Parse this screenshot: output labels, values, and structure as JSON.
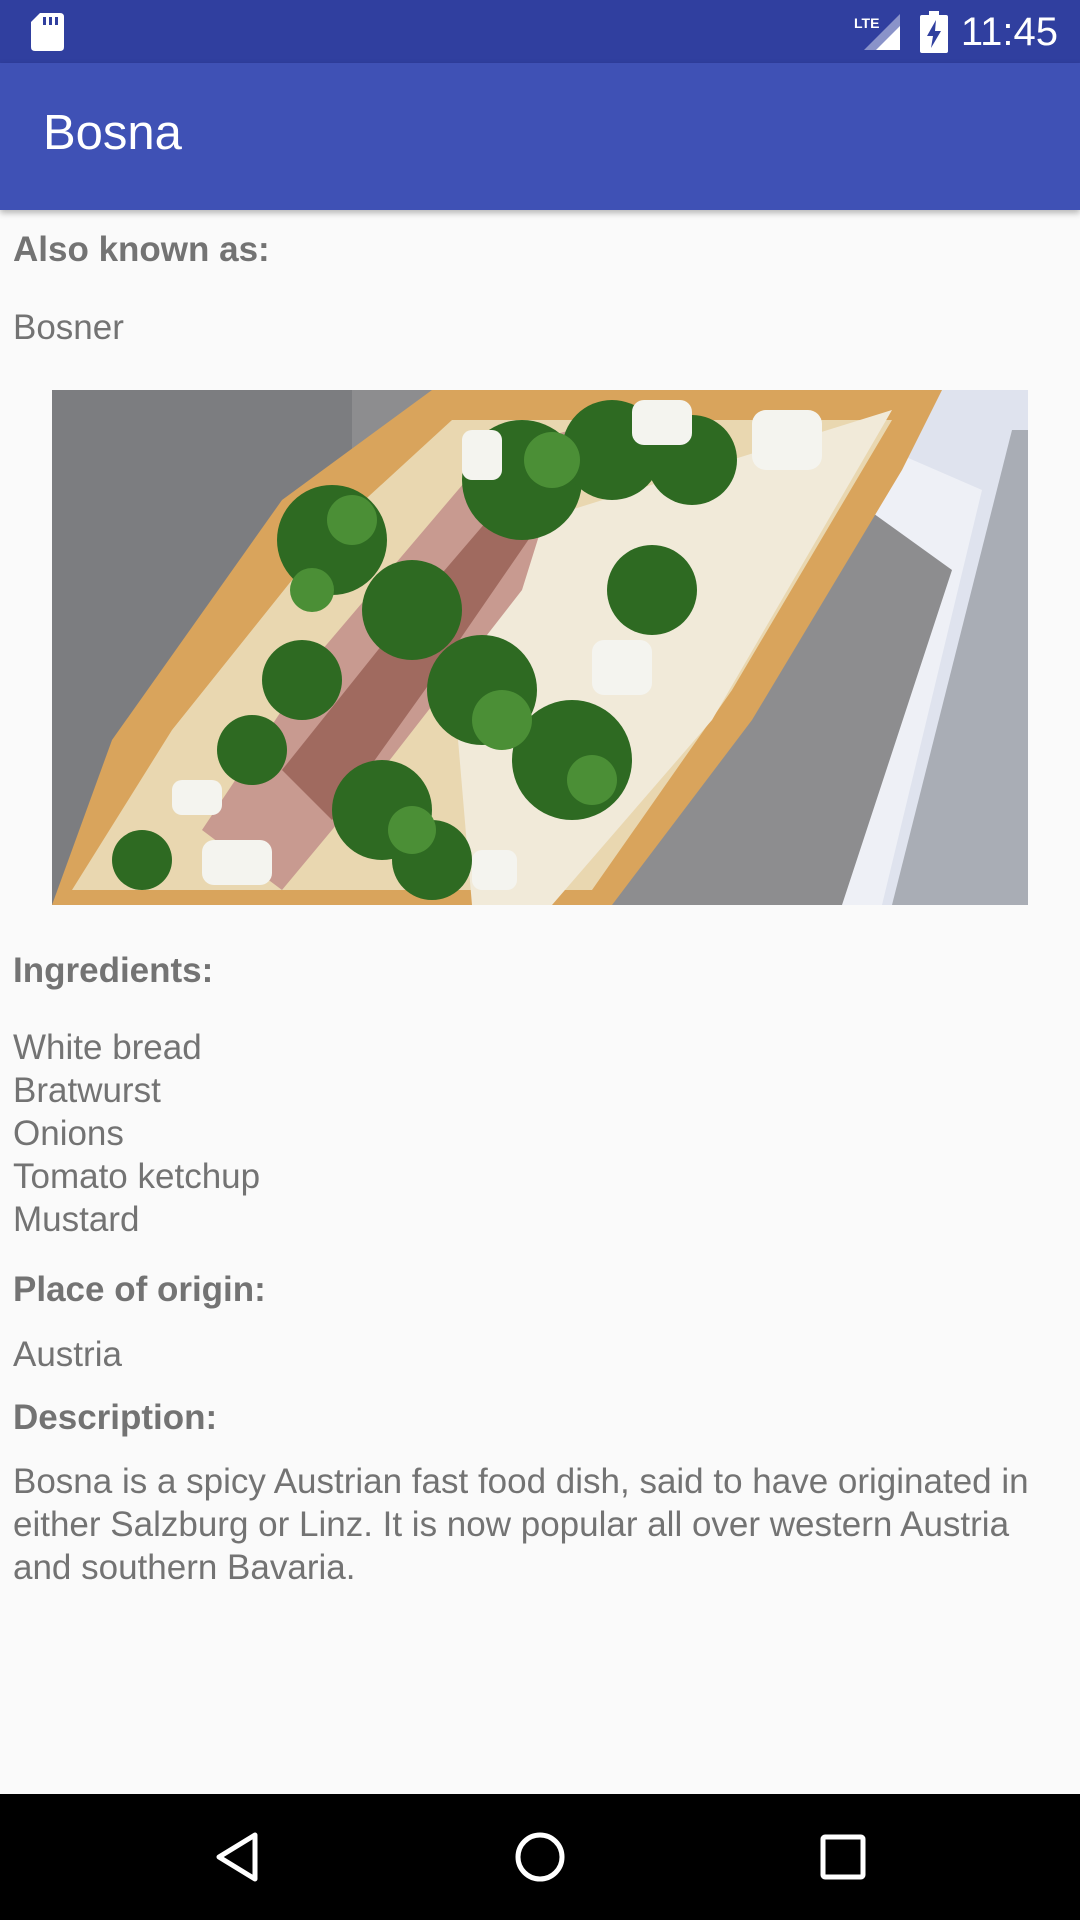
{
  "status_bar": {
    "time": "11:45",
    "network": "LTE",
    "icons": [
      "sd-card-icon",
      "lte-signal-icon",
      "battery-charging-icon"
    ]
  },
  "app_bar": {
    "title": "Bosna"
  },
  "content": {
    "aka_label": "Also known as:",
    "aka_value": "Bosner",
    "image_subject": "bosna-sandwich-photo",
    "ingredients_label": "Ingredients:",
    "ingredients": [
      "White bread",
      "Bratwurst",
      "Onions",
      "Tomato ketchup",
      "Mustard"
    ],
    "origin_label": "Place of origin:",
    "origin_value": "Austria",
    "description_label": "Description:",
    "description_text": "Bosna is a spicy Austrian fast food dish, said to have originated in either Salzburg or Linz. It is now popular all over western Austria and southern Bavaria."
  },
  "nav_bar": {
    "buttons": [
      "back-icon",
      "home-icon",
      "recents-icon"
    ]
  },
  "colors": {
    "status_bar": "#303f9f",
    "app_bar": "#3f51b5",
    "background": "#fafafa",
    "text": "#737373",
    "nav_bar": "#000000"
  }
}
